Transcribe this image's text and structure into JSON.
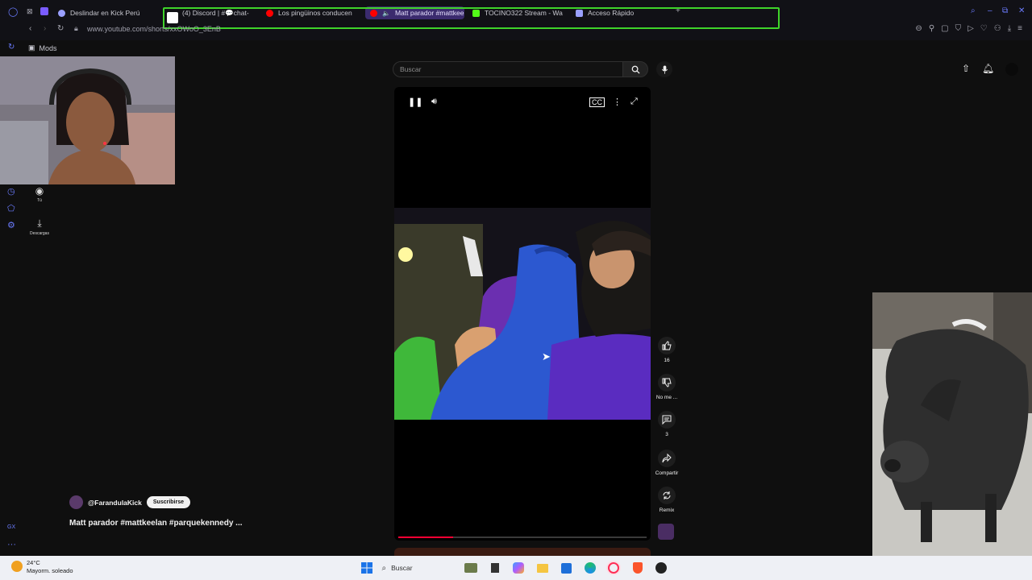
{
  "browser": {
    "tabs": [
      {
        "label": "Deslindar en Kick Perú",
        "color": "#9aa0ff"
      },
      {
        "label": "(4) Discord | #💬chat-",
        "color": "#5865f2"
      },
      {
        "label": "Los pingüinos conducen",
        "color": "#ff0000"
      },
      {
        "label": "Matt parador #mattkee",
        "color": "#ff0000"
      },
      {
        "label": "TOCINO322 Stream - Wa",
        "color": "#53fc18"
      },
      {
        "label": "Acceso Rápido",
        "color": "#9aa0ff"
      }
    ],
    "new_tab": "+",
    "url": "www.youtube.com/shorts/xxOWoO_3EnB",
    "bookmark": "Mods",
    "accent": "#3fd42a"
  },
  "youtube": {
    "search_placeholder": "Buscar",
    "nav": [
      {
        "label": "Tú",
        "icon": "account-circle-icon"
      },
      {
        "label": "Descargas",
        "icon": "download-icon"
      }
    ],
    "actions": {
      "likes": "16",
      "dislike": "No me ...",
      "comments": "3",
      "share": "Compartir",
      "remix": "Remix"
    },
    "channel": "@FarandulaKick",
    "subscribe": "Suscribirse",
    "title": "Matt parador #mattkeelan #parquekennedy ...",
    "progress": 0.22,
    "brand_red": "#ff0033"
  },
  "taskbar": {
    "temp": "24°C",
    "weather": "Mayorm. soleado",
    "search": "Buscar"
  }
}
